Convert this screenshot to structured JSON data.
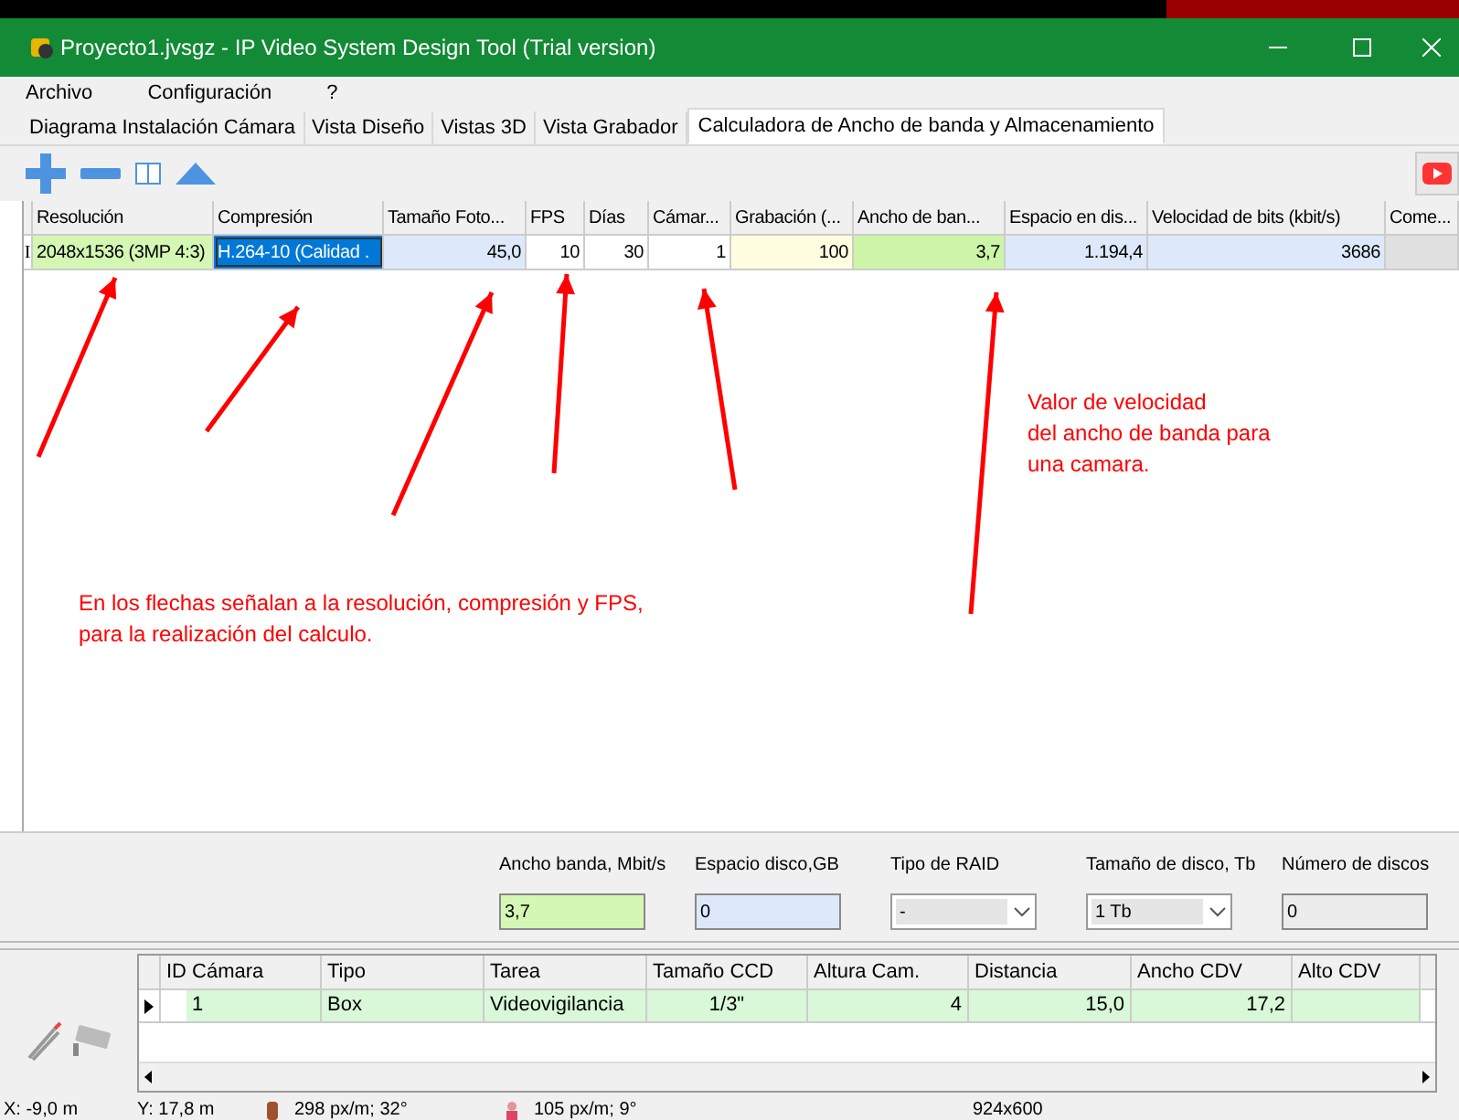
{
  "window": {
    "title": "Proyecto1.jvsgz - IP Video System Design Tool (Trial version)"
  },
  "menu": [
    "Archivo",
    "Configuración",
    "?"
  ],
  "tabs": [
    {
      "label": "Diagrama Instalación Cámara",
      "selected": false
    },
    {
      "label": "Vista Diseño",
      "selected": false
    },
    {
      "label": "Vistas 3D",
      "selected": false
    },
    {
      "label": "Vista Grabador",
      "selected": false
    },
    {
      "label": "Calculadora de Ancho de banda y Almacenamiento",
      "selected": true
    }
  ],
  "table": {
    "row_marker": "I",
    "columns": [
      {
        "label": "Resolución"
      },
      {
        "label": "Compresión"
      },
      {
        "label": "Tamaño Foto..."
      },
      {
        "label": "FPS"
      },
      {
        "label": "Días"
      },
      {
        "label": "Cámar..."
      },
      {
        "label": "Grabación (..."
      },
      {
        "label": "Ancho de ban..."
      },
      {
        "label": "Espacio en dis..."
      },
      {
        "label": "Velocidad de bits (kbit/s)"
      },
      {
        "label": "Come..."
      }
    ],
    "rows": [
      [
        {
          "text": "2048x1536 (3MP 4:3)",
          "color": "#d4f7b4",
          "selected": false
        },
        {
          "text": "H.264-10 (Calidad .",
          "color": "#0078d7",
          "selected": true
        },
        {
          "text": "45,0",
          "color": "#dde9fb",
          "selected": false
        },
        {
          "text": "10",
          "color": "#ffffff",
          "selected": false
        },
        {
          "text": "30",
          "color": "#ffffff",
          "selected": false
        },
        {
          "text": "1",
          "color": "#ffffff",
          "selected": false
        },
        {
          "text": "100",
          "color": "#fffde0",
          "selected": false
        },
        {
          "text": "3,7",
          "color": "#ccf5a8",
          "selected": false
        },
        {
          "text": "1.194,4",
          "color": "#dde9fb",
          "selected": false
        },
        {
          "text": "3686",
          "color": "#dde9fb",
          "selected": false
        },
        {
          "color": "#e0e0e0",
          "selected": false
        }
      ]
    ]
  },
  "annotations": [
    {
      "text": "En los flechas señalan a la resolución, compresión y FPS,\npara la realización del calculo."
    },
    {
      "text": "Valor de velocidad\ndel ancho de banda para\nuna camara."
    }
  ],
  "summary": [
    {
      "label": "Ancho banda, Mbit/s",
      "value": "3,7",
      "kind": "field",
      "color": "#d4f7b4"
    },
    {
      "label": "Espacio disco,GB",
      "value": "0",
      "kind": "field",
      "color": "#dde9fb"
    },
    {
      "label": "Tipo de RAID",
      "value": "-",
      "kind": "dropdown",
      "color": "#e5e5e5"
    },
    {
      "label": "Tamaño de disco, Tb",
      "value": "1 Tb",
      "kind": "dropdown",
      "color": "#e5e5e5"
    },
    {
      "label": "Número de discos",
      "value": "0",
      "kind": "field",
      "color": "#ececec"
    }
  ],
  "cameras": {
    "columns": [
      "ID Cámara",
      "Tipo",
      "Tarea",
      "Tamaño CCD",
      "Altura Cam.",
      "Distancia",
      "Ancho CDV",
      "Alto CDV"
    ],
    "rows": [
      {
        "cells": [
          "1",
          "Box",
          "Videovigilancia",
          "1/3\"",
          "4",
          "15,0",
          "17,2",
          ""
        ]
      }
    ]
  },
  "status_bar": [
    "X: -9,0 m",
    "Y: 17,8 m",
    "298 px/m; 32°",
    "105 px/m; 9°",
    "924x600"
  ]
}
